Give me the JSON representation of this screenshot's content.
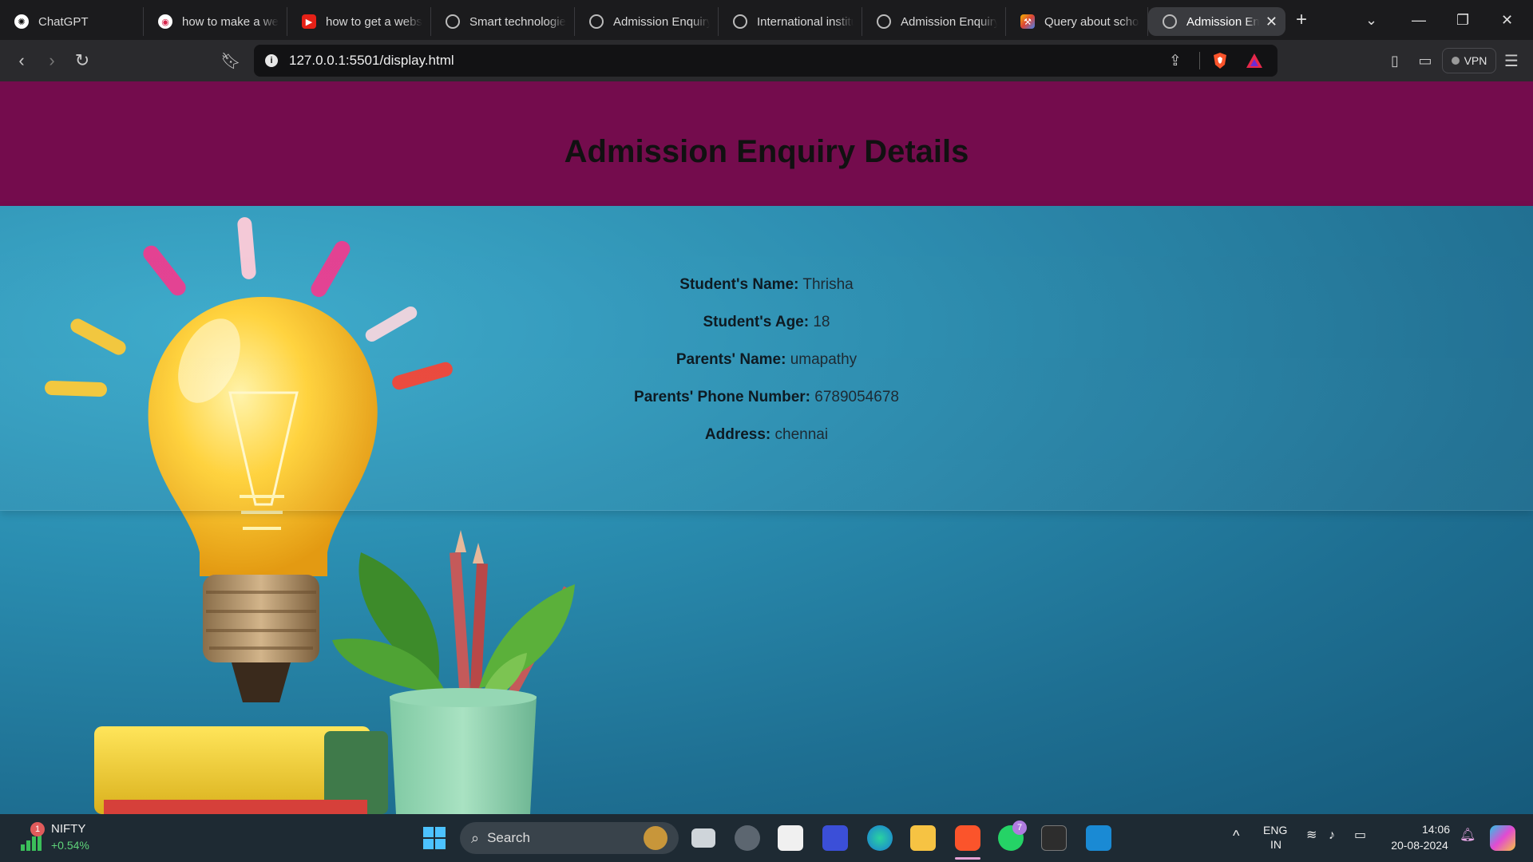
{
  "browser": {
    "tabs": [
      {
        "label": "ChatGPT",
        "icon": "chatgpt-icon"
      },
      {
        "label": "how to make a website",
        "icon": "brave-rewards-icon"
      },
      {
        "label": "how to get a website",
        "icon": "youtube-icon"
      },
      {
        "label": "Smart technologies",
        "icon": "globe-icon"
      },
      {
        "label": "Admission Enquiry",
        "icon": "globe-icon"
      },
      {
        "label": "International institute",
        "icon": "globe-icon"
      },
      {
        "label": "Admission Enquiry",
        "icon": "globe-icon"
      },
      {
        "label": "Query about school",
        "icon": "tools-icon"
      },
      {
        "label": "Admission Enquiry",
        "icon": "globe-icon",
        "active": true
      }
    ],
    "url": "127.0.0.1:5501/display.html",
    "vpn_label": "VPN"
  },
  "page": {
    "title": "Admission Enquiry Details",
    "fields": [
      {
        "label": "Student's Name:",
        "value": "Thrisha"
      },
      {
        "label": "Student's Age:",
        "value": "18"
      },
      {
        "label": "Parents' Name:",
        "value": "umapathy"
      },
      {
        "label": "Parents' Phone Number:",
        "value": "6789054678"
      },
      {
        "label": "Address:",
        "value": "chennai"
      }
    ],
    "colors": {
      "header": "#740c4d",
      "background": "#1e6f92"
    }
  },
  "taskbar": {
    "nifty_label": "NIFTY",
    "nifty_change": "+0.54%",
    "nifty_badge": "1",
    "search_label": "Search",
    "whatsapp_badge": "7",
    "lang_top": "ENG",
    "lang_bottom": "IN",
    "time": "14:06",
    "date": "20-08-2024"
  }
}
